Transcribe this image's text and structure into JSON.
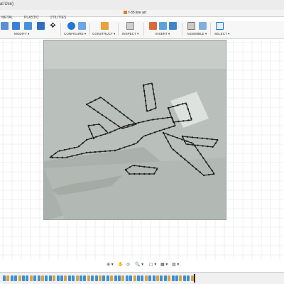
{
  "app": {
    "title": "al Use)"
  },
  "document": {
    "name": "f-35 line art"
  },
  "workspace_tabs": [
    "METAL",
    "PLASTIC",
    "UTILITIES"
  ],
  "toolbar": {
    "groups": [
      {
        "label": "MODIFY ▾",
        "name": "modify"
      },
      {
        "label": "CONFIGURE ▾",
        "name": "configure"
      },
      {
        "label": "CONSTRUCT ▾",
        "name": "construct"
      },
      {
        "label": "INSPECT ▾",
        "name": "inspect"
      },
      {
        "label": "INSERT ▾",
        "name": "insert"
      },
      {
        "label": "ASSEMBLE ▾",
        "name": "assemble"
      },
      {
        "label": "SELECT ▾",
        "name": "select"
      }
    ]
  },
  "colors": {
    "accent": "#1f78d1",
    "plane_bg": "#b9bfba",
    "grid": "#e4e4e4",
    "timeline_feature": "#3a8fd8",
    "timeline_sketch": "#d9a23b",
    "marker": "#2a2a2a"
  },
  "icons": {
    "doc": "fusion-doc-icon",
    "move": "move-icon",
    "orbit": "orbit-icon",
    "pan": "pan-icon",
    "zoom": "zoom-icon",
    "fit": "fit-icon",
    "display": "display-settings-icon",
    "grid": "grid-settings-icon",
    "viewports": "viewports-icon"
  },
  "nav": [
    "⊕ ▾",
    "✋",
    "⊙",
    "🔍 ▾",
    "▢ ▾",
    "▦ ▾",
    "▥ ▾"
  ]
}
